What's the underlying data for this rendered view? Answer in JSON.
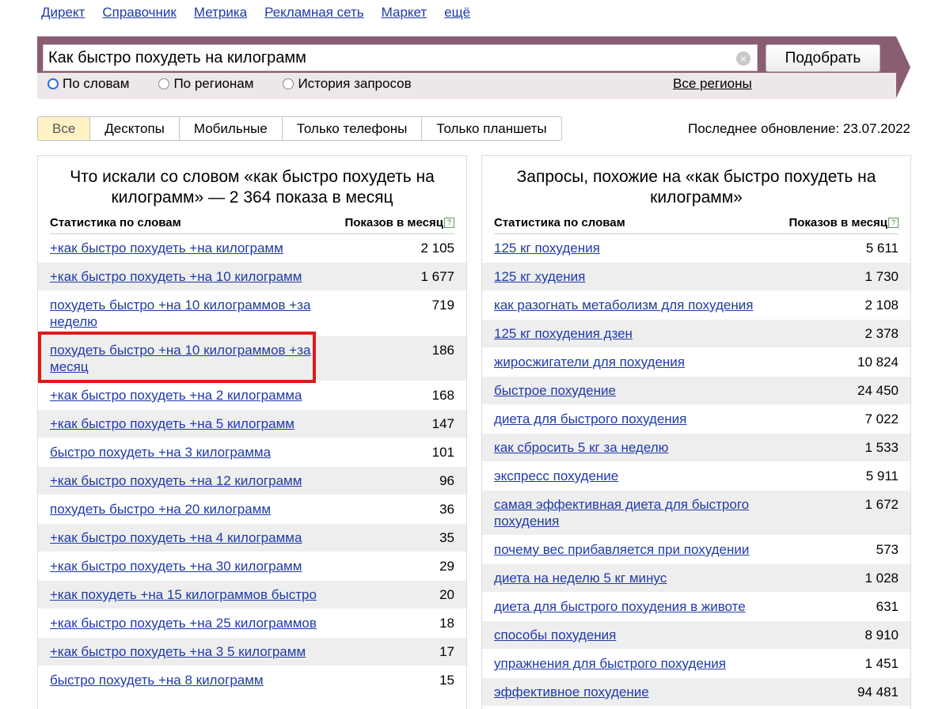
{
  "nav": [
    "Директ",
    "Справочник",
    "Метрика",
    "Рекламная сеть",
    "Маркет",
    "ещё"
  ],
  "search": {
    "value": "Как быстро похудеть на килограмм",
    "clear_glyph": "×",
    "button": "Подобрать",
    "modes": [
      "По словам",
      "По регионам",
      "История запросов"
    ],
    "selected_mode": "По словам",
    "regions": "Все регионы"
  },
  "tabs": [
    "Все",
    "Десктопы",
    "Мобильные",
    "Только телефоны",
    "Только планшеты"
  ],
  "active_tab": "Все",
  "last_update": "Последнее обновление: 23.07.2022",
  "left": {
    "title": "Что искали со словом «как быстро похудеть на килограмм» — 2 364 показа в месяц",
    "col_words": "Статистика по словам",
    "col_shows": "Показов в месяц",
    "help_glyph": "?",
    "rows": [
      {
        "q": "+как быстро похудеть +на килограмм",
        "n": "2 105"
      },
      {
        "q": "+как быстро похудеть +на 10 килограмм",
        "n": "1 677"
      },
      {
        "q": "похудеть быстро +на 10 килограммов +за неделю",
        "n": "719"
      },
      {
        "q": "похудеть быстро +на 10 килограммов +за месяц",
        "n": "186"
      },
      {
        "q": "+как быстро похудеть +на 2 килограмма",
        "n": "168"
      },
      {
        "q": "+как быстро похудеть +на 5 килограмм",
        "n": "147"
      },
      {
        "q": "быстро похудеть +на 3 килограмма",
        "n": "101"
      },
      {
        "q": "+как быстро похудеть +на 12 килограмм",
        "n": "96"
      },
      {
        "q": "похудеть быстро +на 20 килограмм",
        "n": "36"
      },
      {
        "q": "+как быстро похудеть +на 4 килограмма",
        "n": "35"
      },
      {
        "q": "+как быстро похудеть +на 30 килограмм",
        "n": "29"
      },
      {
        "q": "+как похудеть +на 15 килограммов быстро",
        "n": "20"
      },
      {
        "q": "+как быстро похудеть +на 25 килограммов",
        "n": "18"
      },
      {
        "q": "+как быстро похудеть +на 3 5 килограмм",
        "n": "17"
      },
      {
        "q": "быстро похудеть +на 8 килограмм",
        "n": "15"
      }
    ]
  },
  "right": {
    "title": "Запросы, похожие на «как быстро похудеть на килограмм»",
    "col_words": "Статистика по словам",
    "col_shows": "Показов в месяц",
    "help_glyph": "?",
    "rows": [
      {
        "q": "125 кг похудения",
        "n": "5 611"
      },
      {
        "q": "125 кг худения",
        "n": "1 730"
      },
      {
        "q": "как разогнать метаболизм для похудения",
        "n": "2 108"
      },
      {
        "q": "125 кг похудения дзен",
        "n": "2 378"
      },
      {
        "q": "жиросжигатели для похудения",
        "n": "10 824"
      },
      {
        "q": "быстрое похудение",
        "n": "24 450"
      },
      {
        "q": "диета для быстрого похудения",
        "n": "7 022"
      },
      {
        "q": "как сбросить 5 кг за неделю",
        "n": "1 533"
      },
      {
        "q": "экспресс похудение",
        "n": "5 911"
      },
      {
        "q": "самая эффективная диета для быстрого похудения",
        "n": "1 672"
      },
      {
        "q": "почему вес прибавляется при похудении",
        "n": "573"
      },
      {
        "q": "диета на неделю 5 кг минус",
        "n": "1 028"
      },
      {
        "q": "диета для быстрого похудения в животе",
        "n": "631"
      },
      {
        "q": "способы похудения",
        "n": "8 910"
      },
      {
        "q": "упражнения для быстрого похудения",
        "n": "1 451"
      },
      {
        "q": "эффективное похудение",
        "n": "94 481"
      }
    ]
  }
}
